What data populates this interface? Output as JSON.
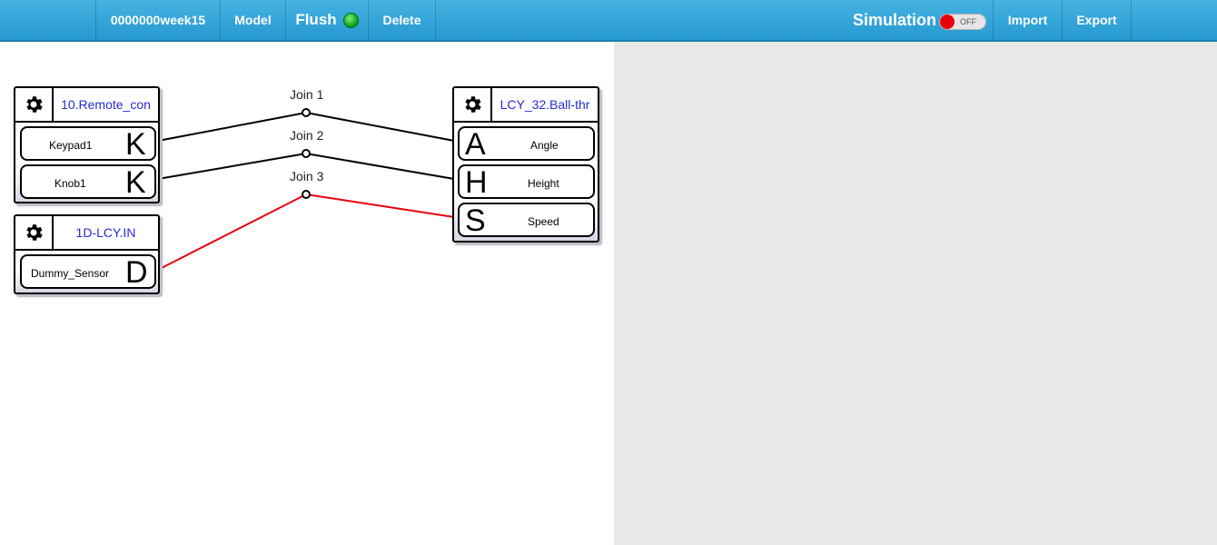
{
  "toolbar": {
    "project_name": "0000000week15",
    "model_label": "Model",
    "flush_label": "Flush",
    "delete_label": "Delete",
    "simulation_label": "Simulation",
    "simulation_toggle": "OFF",
    "import_label": "Import",
    "export_label": "Export"
  },
  "blocks": {
    "remote": {
      "title": "10.Remote_con",
      "ports": [
        {
          "label": "Keypad1",
          "letter": "K"
        },
        {
          "label": "Knob1",
          "letter": "K"
        }
      ]
    },
    "sensor": {
      "title": "1D-LCY.IN",
      "ports": [
        {
          "label": "Dummy_Sensor",
          "letter": "D"
        }
      ]
    },
    "ball": {
      "title": "LCY_32.Ball-thr",
      "ports": [
        {
          "label": "Angle",
          "letter": "A"
        },
        {
          "label": "Height",
          "letter": "H"
        },
        {
          "label": "Speed",
          "letter": "S"
        }
      ]
    }
  },
  "joins": [
    {
      "label": "Join 1",
      "color": "#000000"
    },
    {
      "label": "Join 2",
      "color": "#000000"
    },
    {
      "label": "Join 3",
      "color": "#e8000b"
    }
  ],
  "colors": {
    "topbar": "#2aa1d8",
    "block_title": "#2a2ad8",
    "active_wire": "#e8000b",
    "flush_led": "#12a81e",
    "simulation_off": "#e8000b"
  }
}
